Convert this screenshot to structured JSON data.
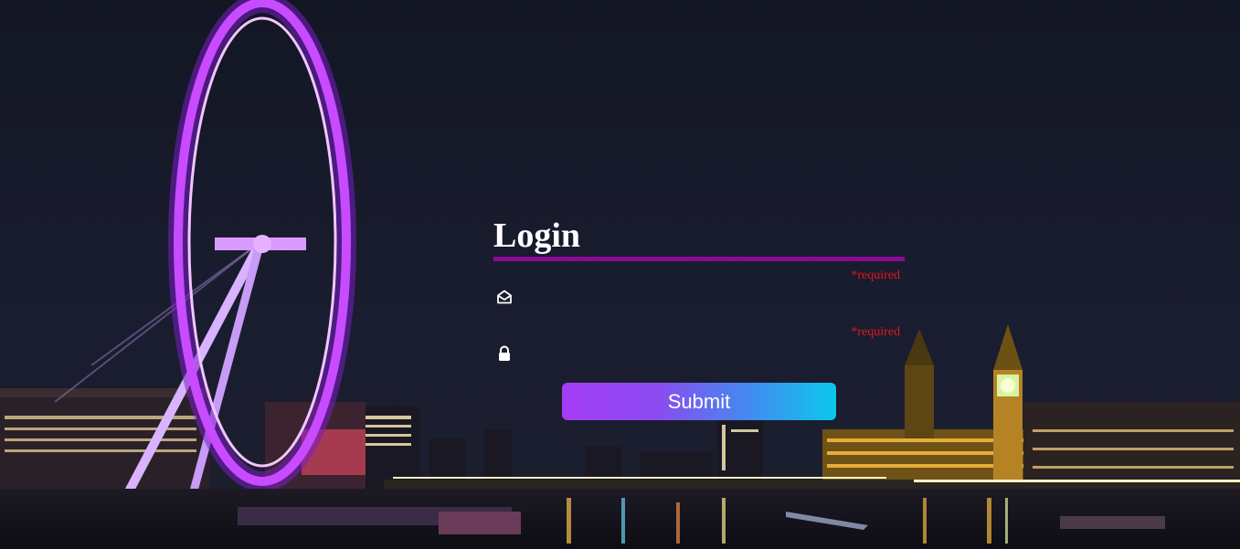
{
  "login": {
    "title": "Login",
    "email": {
      "required_label": "*required",
      "value": "",
      "icon": "envelope-open-icon"
    },
    "password": {
      "required_label": "*required",
      "value": "",
      "icon": "lock-icon"
    },
    "submit_label": "Submit"
  },
  "colors": {
    "title_underline": "#8a0a96",
    "required_text": "#e01818",
    "submit_gradient_start": "#a53cf7",
    "submit_gradient_end": "#0cc8ea",
    "sky": "#141828"
  }
}
